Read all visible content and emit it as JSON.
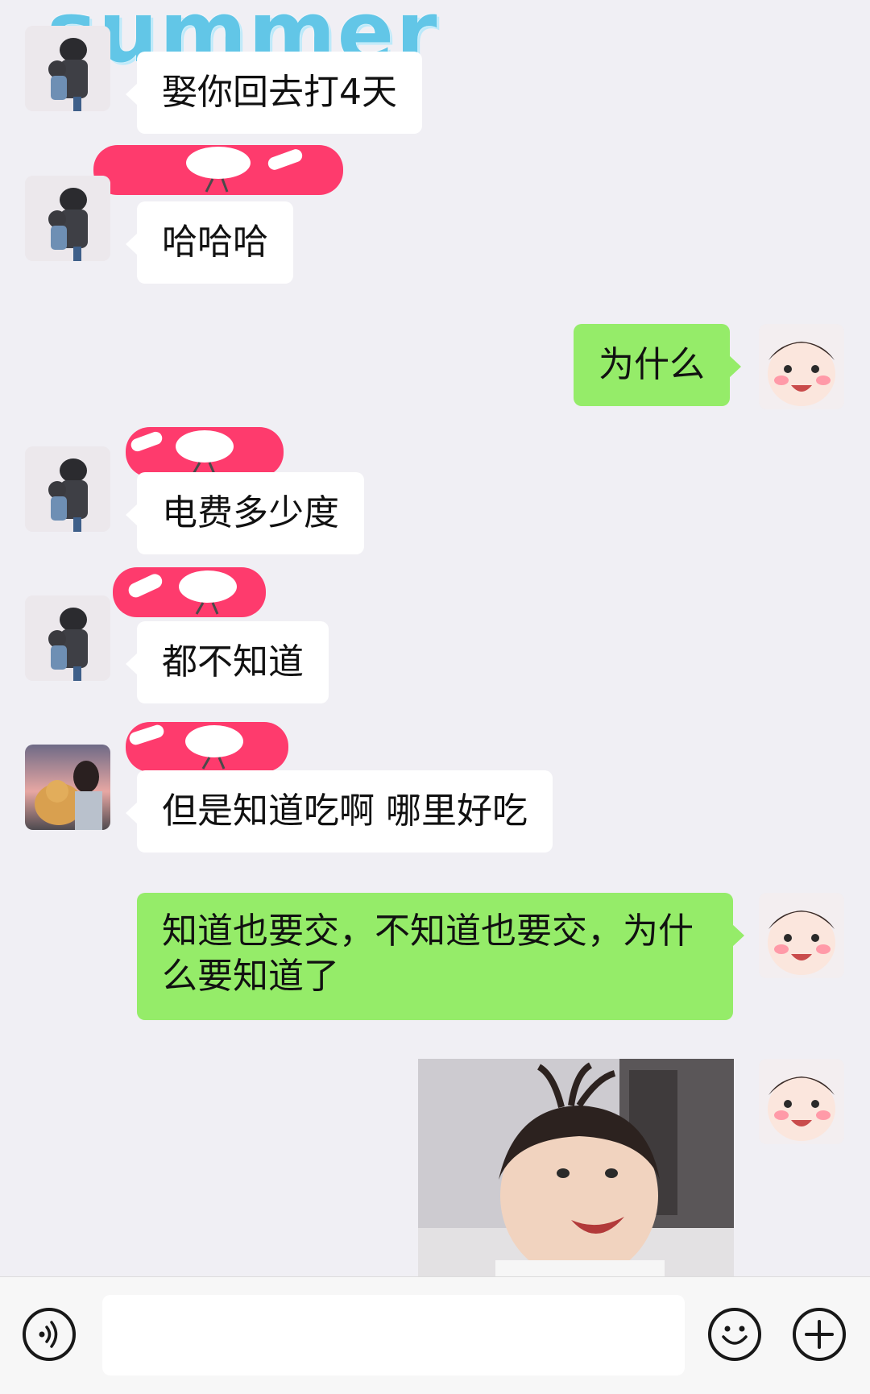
{
  "watermark": {
    "text": "summer"
  },
  "messages": [
    {
      "id": "m1",
      "direction": "in",
      "avatar": "boy-avatar",
      "text": "娶你回去打4天"
    },
    {
      "id": "m2",
      "direction": "in",
      "avatar": "boy-avatar",
      "text": "哈哈哈"
    },
    {
      "id": "m3",
      "direction": "out",
      "avatar": "baby-avatar",
      "text": "为什么"
    },
    {
      "id": "m4",
      "direction": "in",
      "avatar": "boy-avatar",
      "text": "电费多少度"
    },
    {
      "id": "m5",
      "direction": "in",
      "avatar": "boy-avatar",
      "text": "都不知道"
    },
    {
      "id": "m6",
      "direction": "in",
      "avatar": "girl-dog-avatar",
      "text": "但是知道吃啊 哪里好吃"
    },
    {
      "id": "m7",
      "direction": "out",
      "avatar": "baby-avatar",
      "text": "知道也要交，不知道也要交，为什么要知道了"
    },
    {
      "id": "m8",
      "direction": "out",
      "avatar": "baby-avatar",
      "type": "image",
      "content": "laughing-toddler-photo"
    }
  ],
  "redaction_stickers": {
    "label": "goose"
  },
  "input_bar": {
    "voice_icon": "voice-icon",
    "emoji_icon": "emoji-icon",
    "plus_icon": "plus-icon",
    "field_value": ""
  },
  "colors": {
    "background": "#f0eff4",
    "incoming_bubble": "#ffffff",
    "outgoing_bubble": "#95ec69",
    "redaction": "#fe3b6d",
    "watermark": "#56c3e6"
  }
}
